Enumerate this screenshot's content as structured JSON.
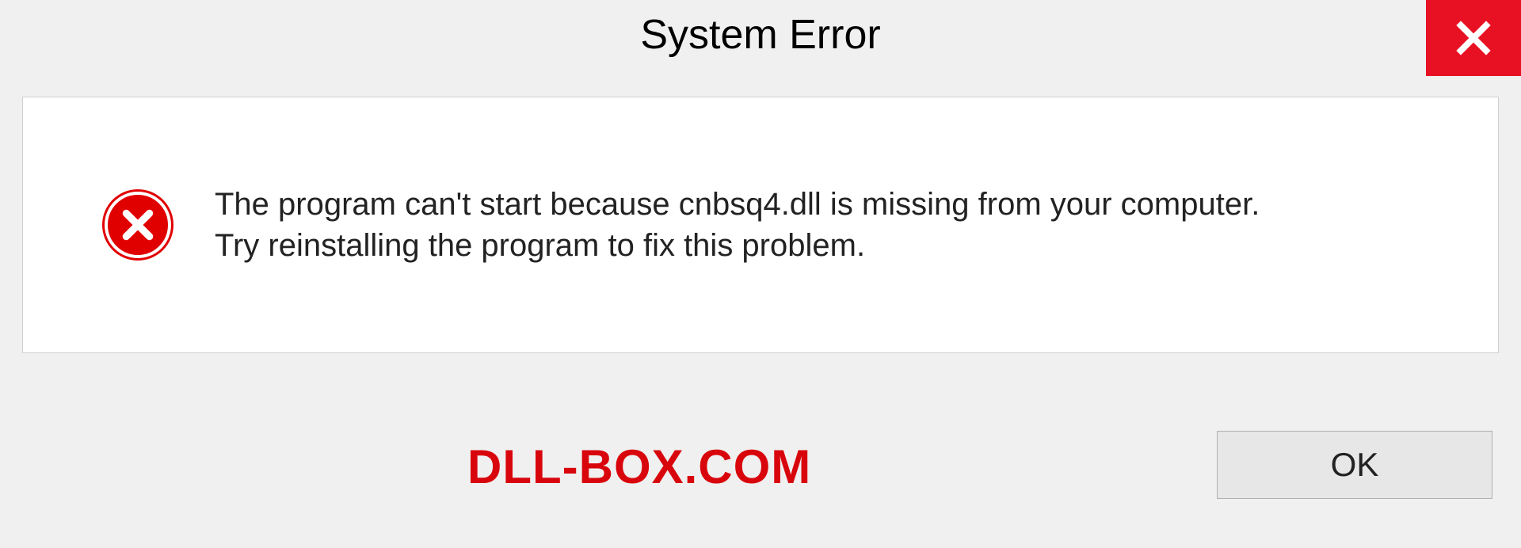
{
  "titlebar": {
    "title": "System Error"
  },
  "content": {
    "message_line1": "The program can't start because cnbsq4.dll is missing from your computer.",
    "message_line2": "Try reinstalling the program to fix this problem."
  },
  "buttons": {
    "ok_label": "OK"
  },
  "watermark": {
    "text": "DLL-BOX.COM"
  },
  "colors": {
    "close_bg": "#e81123",
    "error_icon_bg": "#e10000",
    "watermark_color": "#d8060c"
  }
}
